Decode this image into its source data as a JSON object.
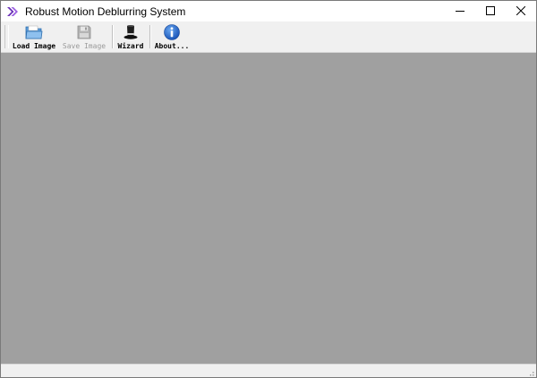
{
  "window": {
    "title": "Robust Motion Deblurring System"
  },
  "titlebar": {
    "app_icon": "purple-chevron-icon",
    "minimize_icon": "minimize-icon",
    "maximize_icon": "maximize-icon",
    "close_icon": "close-icon"
  },
  "toolbar": {
    "items": [
      {
        "label": "Load Image",
        "icon": "folder-open-icon",
        "enabled": true
      },
      {
        "label": "Save Image",
        "icon": "floppy-disk-icon",
        "enabled": false
      },
      {
        "label": "Wizard",
        "icon": "wizard-hat-icon",
        "enabled": true
      },
      {
        "label": "About...",
        "icon": "info-icon",
        "enabled": true
      }
    ]
  },
  "colors": {
    "canvas_background": "#a0a0a0",
    "toolbar_background": "#f0f0f0",
    "info_icon_blue": "#1a63c6",
    "app_icon_purple": "#7b3fc4"
  }
}
